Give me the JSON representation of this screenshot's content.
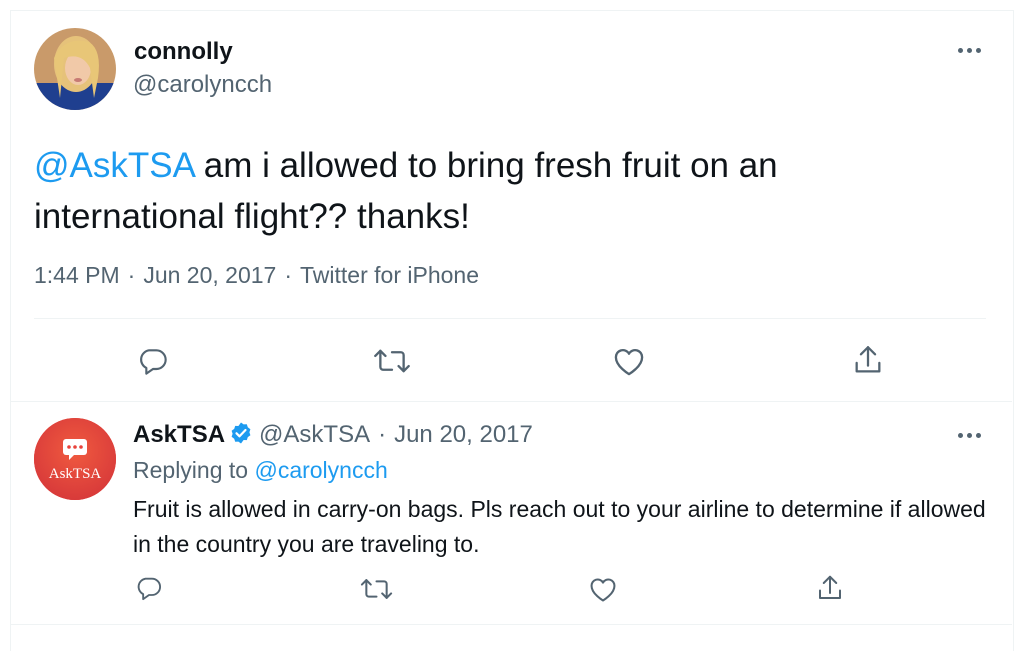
{
  "main_tweet": {
    "author_name": "connolly",
    "author_handle": "@carolyncch",
    "mention": "@AskTSA",
    "text": " am i allowed to bring fresh fruit on an international flight?? thanks!",
    "time": "1:44 PM",
    "date": "Jun 20, 2017",
    "source": "Twitter for iPhone",
    "separator": "·"
  },
  "reply_tweet": {
    "author_name": "AskTSA",
    "author_handle": "@AskTSA",
    "separator": "·",
    "date": "Jun 20, 2017",
    "replying_label": "Replying to",
    "replying_handle": "@carolyncch",
    "text": "Fruit is allowed in carry-on bags. Pls reach out to your airline to determine if allowed in the country you are traveling to.",
    "avatar_logo_text": "AskTSA",
    "verified": true
  },
  "icons": {
    "reply": "reply-icon",
    "retweet": "retweet-icon",
    "like": "like-icon",
    "share": "share-icon",
    "more": "more-icon"
  },
  "colors": {
    "accent": "#1d9bf0",
    "text": "#0f1419",
    "secondary": "#536471",
    "tsa_avatar": "#e8423b"
  }
}
